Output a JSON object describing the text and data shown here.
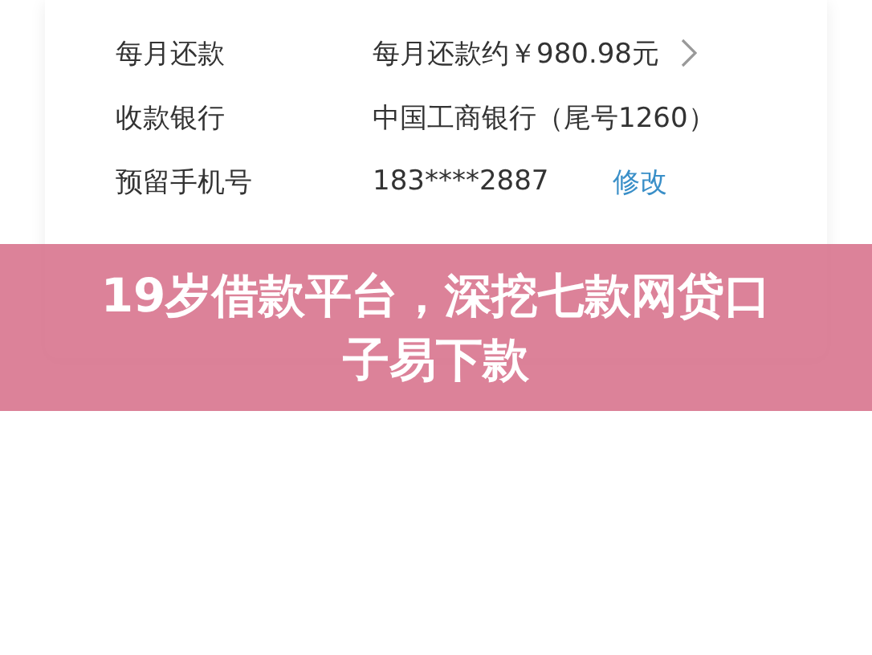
{
  "rows": [
    {
      "label": "每月还款",
      "value": "每月还款约￥980.98元",
      "kind": "chevron"
    },
    {
      "label": "收款银行",
      "value": "中国工商银行（尾号1260）",
      "kind": "plain"
    },
    {
      "label": "预留手机号",
      "value": "183****2887",
      "kind": "action",
      "action": "修改"
    }
  ],
  "banner": {
    "title": "19岁借款平台，深挖七款网贷口子易下款"
  }
}
